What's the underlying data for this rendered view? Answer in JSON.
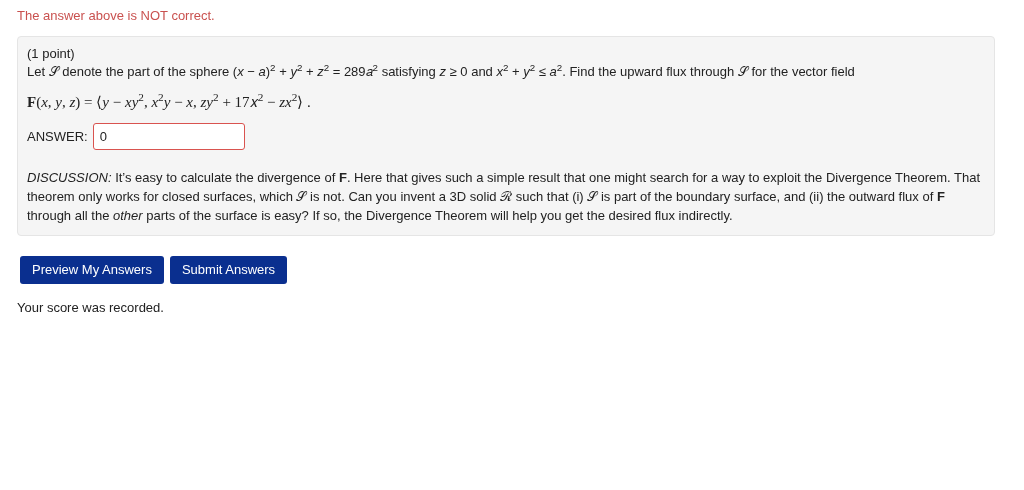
{
  "feedback": "The answer above is NOT correct.",
  "problem": {
    "points": "(1 point)",
    "statement": "Let 𝒮 denote the part of the sphere (*x* − *a*)$^{2}$ + *y*$^{2}$ + *z*$^{2}$ = 289𝑎$^{2}$ satisfying *z* ≥ 0 and *x*$^{2}$ + *y*$^{2}$ ≤ *a*$^{2}$. Find the upward flux through 𝒮 for the vector field",
    "formula": "**F**(*x*, *y*, *z*) = ⟨*y* − *xy*$^{2}$, *x*$^{2}$*y* − *x*, *zy*$^{2}$ + 17𝑥$^{2}$ − *zx*$^{2}$⟩ .",
    "answer": {
      "label": "ANSWER:",
      "value": "0",
      "incorrect": true
    },
    "discussion": "*DISCUSSION:* It’s easy to calculate the divergence of **F**. Here that gives such a simple result that one might search for a way to exploit the Divergence Theorem. That theorem only works for closed surfaces, which 𝒮 is not. Can you invent a 3D solid ℛ such that (i) 𝒮 is part of the boundary surface, and (ii) the outward flux of **F** through all the *other* parts of the surface is easy? If so, the Divergence Theorem will help you get the desired flux indirectly."
  },
  "buttons": [
    "Preview My Answers",
    "Submit Answers"
  ],
  "status": "Your score was recorded."
}
